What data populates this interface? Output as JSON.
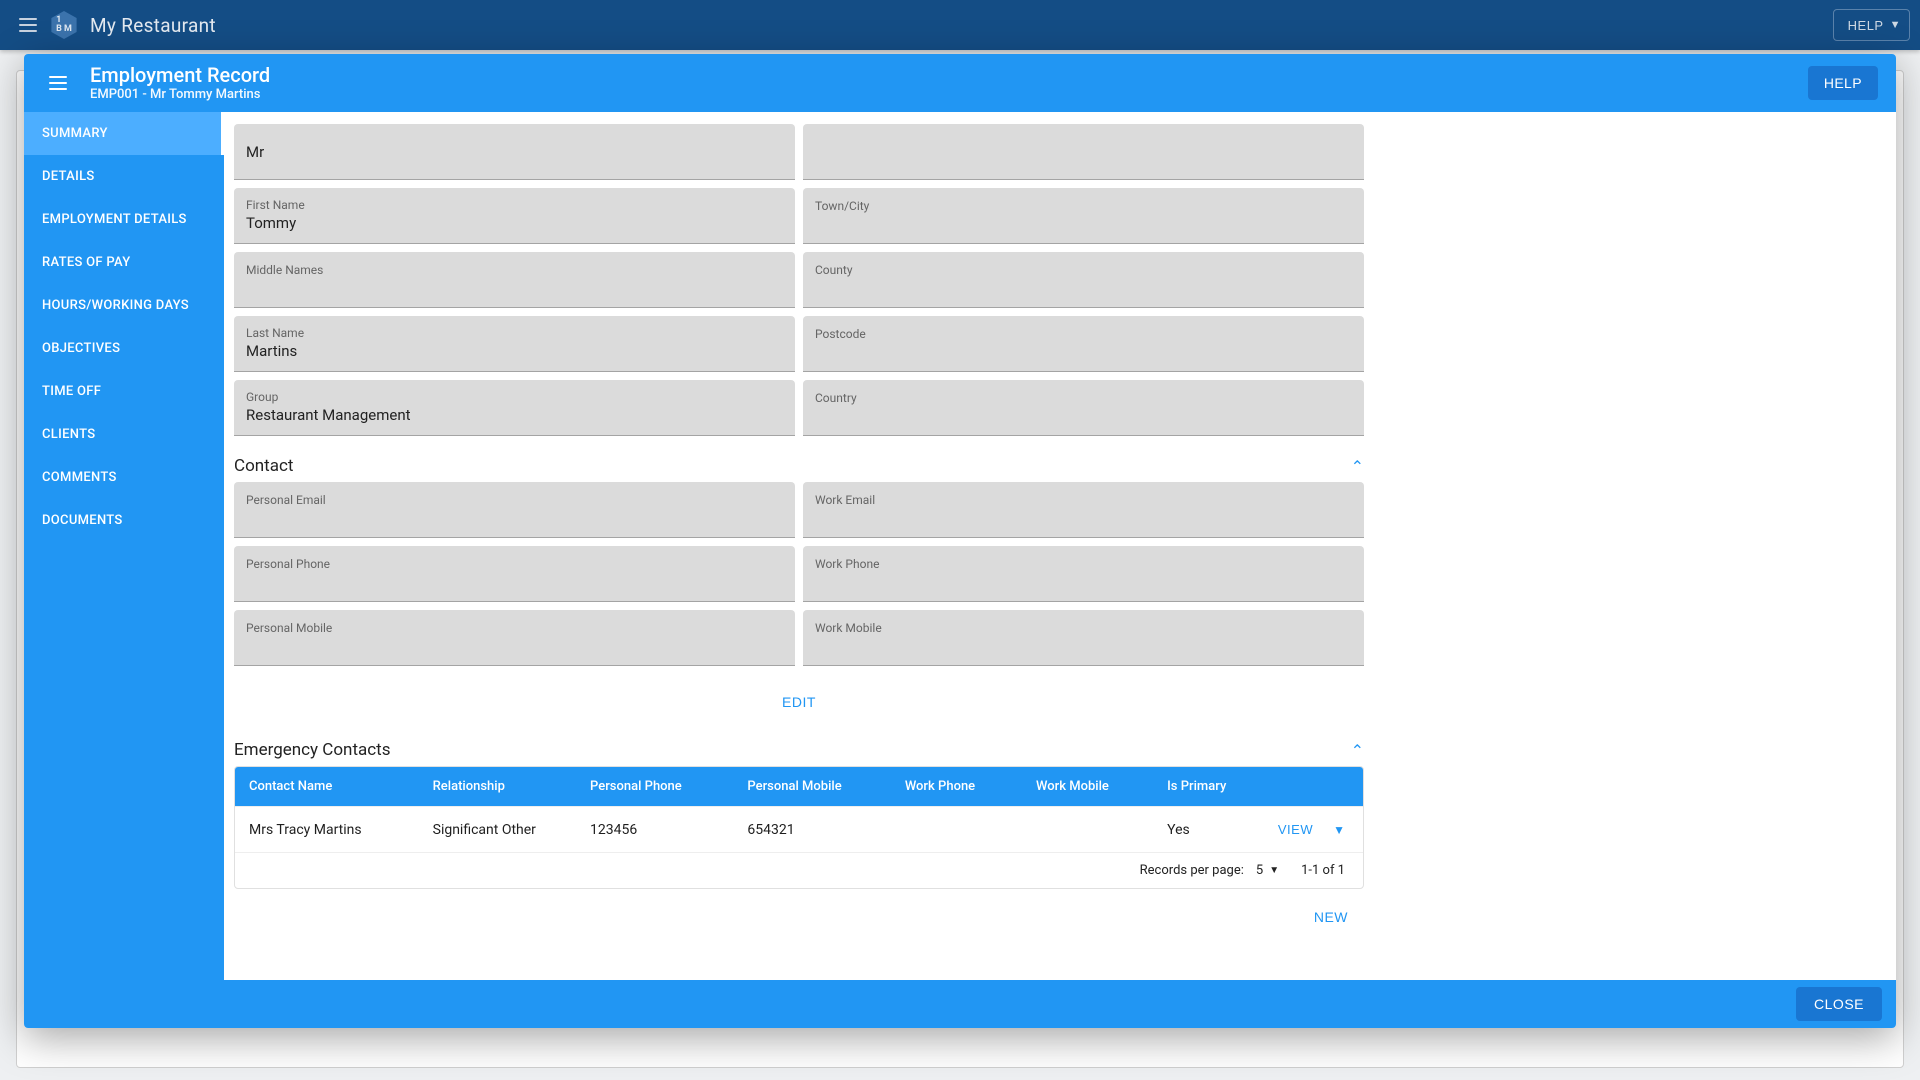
{
  "topbar": {
    "app_title": "My Restaurant",
    "help_label": "HELP"
  },
  "modal": {
    "title": "Employment Record",
    "subtitle": "EMP001 - Mr Tommy Martins",
    "help_label": "HELP",
    "close_label": "CLOSE"
  },
  "sidebar": {
    "items": [
      {
        "label": "SUMMARY"
      },
      {
        "label": "DETAILS"
      },
      {
        "label": "EMPLOYMENT DETAILS"
      },
      {
        "label": "RATES OF PAY"
      },
      {
        "label": "HOURS/WORKING DAYS"
      },
      {
        "label": "OBJECTIVES"
      },
      {
        "label": "TIME OFF"
      },
      {
        "label": "CLIENTS"
      },
      {
        "label": "COMMENTS"
      },
      {
        "label": "DOCUMENTS"
      }
    ],
    "active_index": 0
  },
  "details": {
    "fields_left": [
      {
        "label": "",
        "value": "Mr"
      },
      {
        "label": "First Name",
        "value": "Tommy"
      },
      {
        "label": "Middle Names",
        "value": ""
      },
      {
        "label": "Last Name",
        "value": "Martins"
      },
      {
        "label": "Group",
        "value": "Restaurant Management"
      }
    ],
    "fields_right": [
      {
        "label": "",
        "value": ""
      },
      {
        "label": "Town/City",
        "value": ""
      },
      {
        "label": "County",
        "value": ""
      },
      {
        "label": "Postcode",
        "value": ""
      },
      {
        "label": "Country",
        "value": ""
      }
    ]
  },
  "contact": {
    "section_title": "Contact",
    "fields_left": [
      {
        "label": "Personal Email",
        "value": ""
      },
      {
        "label": "Personal Phone",
        "value": ""
      },
      {
        "label": "Personal Mobile",
        "value": ""
      }
    ],
    "fields_right": [
      {
        "label": "Work Email",
        "value": ""
      },
      {
        "label": "Work Phone",
        "value": ""
      },
      {
        "label": "Work Mobile",
        "value": ""
      }
    ],
    "edit_label": "EDIT"
  },
  "emergency": {
    "section_title": "Emergency Contacts",
    "headers": [
      "Contact Name",
      "Relationship",
      "Personal Phone",
      "Personal Mobile",
      "Work Phone",
      "Work Mobile",
      "Is Primary"
    ],
    "rows": [
      {
        "name": "Mrs Tracy Martins",
        "relationship": "Significant Other",
        "pphone": "123456",
        "pmobile": "654321",
        "wphone": "",
        "wmobile": "",
        "primary": "Yes"
      }
    ],
    "view_label": "VIEW",
    "records_label": "Records per page:",
    "records_per_page": "5",
    "range_label": "1-1 of 1",
    "new_label": "NEW"
  }
}
